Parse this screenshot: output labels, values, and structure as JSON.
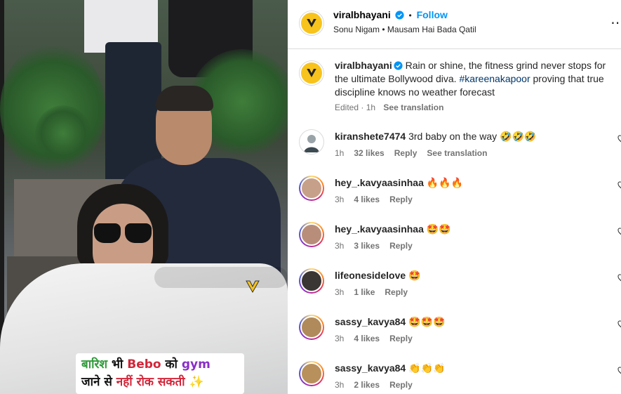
{
  "media": {
    "overlay_line1": [
      {
        "text": "बारिश ",
        "color": "green"
      },
      {
        "text": "भी ",
        "color": "black"
      },
      {
        "text": "Bebo ",
        "color": "red"
      },
      {
        "text": "को ",
        "color": "black"
      },
      {
        "text": "gym",
        "color": "purple"
      }
    ],
    "overlay_line2": [
      {
        "text": "जाने से ",
        "color": "black"
      },
      {
        "text": "नहीं रोक सकती ",
        "color": "red"
      },
      {
        "text": "✨",
        "color": "black"
      }
    ],
    "watermark": "V"
  },
  "header": {
    "username": "viralbhayani",
    "follow_label": "Follow",
    "separator": "•",
    "audio": "Sonu Nigam • Mausam Hai Bada Qatil",
    "more": "⋯"
  },
  "post": {
    "username": "viralbhayani",
    "caption_before": " Rain or shine, the fitness grind never stops for the ultimate Bollywood diva. ",
    "hashtag": "#kareenakapoor",
    "caption_after": " proving that true discipline knows no weather forecast",
    "edited": "Edited · 1h",
    "see_translation": "See translation"
  },
  "comments": [
    {
      "username": "kiranshete7474",
      "text": "3rd baby on the way",
      "emoji": "🤣🤣🤣",
      "time": "1h",
      "likes": "32 likes",
      "reply": "Reply",
      "extra": "See translation",
      "avatar_color": "#9aa3a8",
      "story": false
    },
    {
      "username": "hey_.kavyaasinhaa",
      "text": "",
      "emoji": "🔥🔥🔥",
      "time": "3h",
      "likes": "4 likes",
      "reply": "Reply",
      "extra": "",
      "avatar_color": "#c7a08a",
      "story": true
    },
    {
      "username": "hey_.kavyaasinhaa",
      "text": "",
      "emoji": "🤩🤩",
      "time": "3h",
      "likes": "3 likes",
      "reply": "Reply",
      "extra": "",
      "avatar_color": "#b88e7a",
      "story": true
    },
    {
      "username": "lifeonesidelove",
      "text": "",
      "emoji": "🤩",
      "time": "3h",
      "likes": "1 like",
      "reply": "Reply",
      "extra": "",
      "avatar_color": "#3a3634",
      "story": true
    },
    {
      "username": "sassy_kavya84",
      "text": "",
      "emoji": "🤩🤩🤩",
      "time": "3h",
      "likes": "4 likes",
      "reply": "Reply",
      "extra": "",
      "avatar_color": "#b08a5a",
      "story": true
    },
    {
      "username": "sassy_kavya84",
      "text": "",
      "emoji": "👏👏👏",
      "time": "3h",
      "likes": "2 likes",
      "reply": "Reply",
      "extra": "",
      "avatar_color": "#b8905c",
      "story": true
    }
  ],
  "colors": {
    "accent": "#0095f6",
    "hashtag": "#00376b",
    "muted": "#737373",
    "brand_yellow": "#f7c31c"
  }
}
